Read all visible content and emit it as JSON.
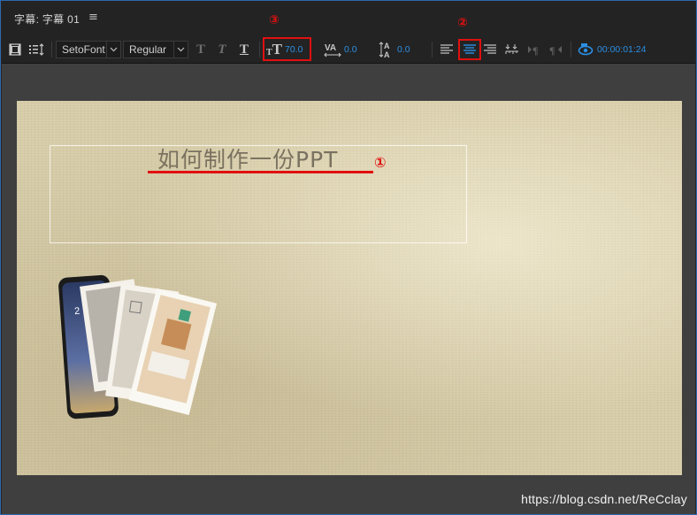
{
  "header": {
    "tab_title": "字幕: 字幕 01",
    "menu_icon": "≡"
  },
  "toolbar": {
    "font_family": "SetoFont",
    "font_style": "Regular",
    "font_size": "70.0",
    "kerning": "0.0",
    "leading": "0.0",
    "timecode": "00:00:01:24",
    "align_selected": "center"
  },
  "canvas": {
    "title_text": "如何制作一份PPT"
  },
  "annotations": {
    "marker_1": "①",
    "marker_2": "②",
    "marker_3": "③",
    "color": "#e01010"
  },
  "watermark": "https://blog.csdn.net/ReCclay"
}
